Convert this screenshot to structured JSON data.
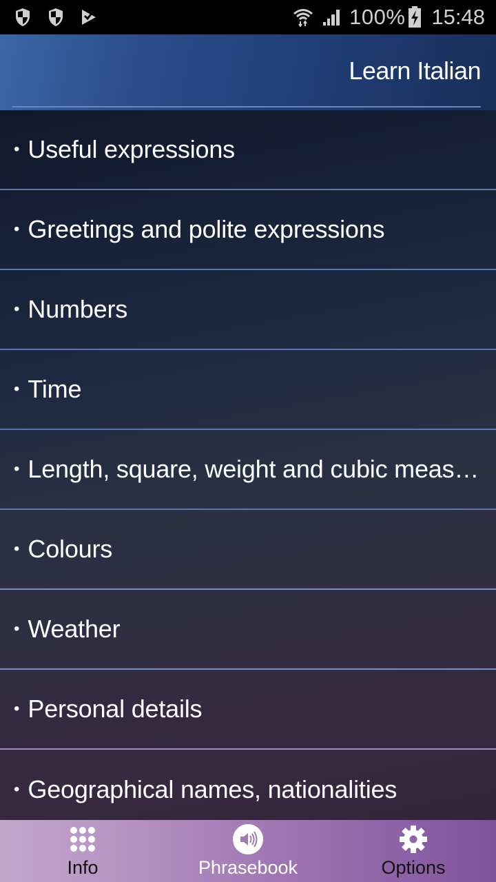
{
  "status_bar": {
    "left_icons": [
      "shield-icon",
      "shield-icon",
      "play-store-check-icon"
    ],
    "wifi_icon": "wifi-icon",
    "signal_icon": "signal-icon",
    "battery_percent": "100%",
    "battery_icon": "battery-charging-icon",
    "time": "15:48"
  },
  "header": {
    "title": "Learn Italian"
  },
  "topics": [
    {
      "label": "Useful expressions"
    },
    {
      "label": "Greetings and polite expressions"
    },
    {
      "label": "Numbers"
    },
    {
      "label": "Time"
    },
    {
      "label": "Length, square, weight and cubic measures"
    },
    {
      "label": "Colours"
    },
    {
      "label": "Weather"
    },
    {
      "label": "Personal details"
    },
    {
      "label": "Geographical names, nationalities"
    }
  ],
  "bullet": "•",
  "bottom_nav": {
    "items": [
      {
        "label": "Info",
        "icon": "grid-dots-icon",
        "active": false
      },
      {
        "label": "Phrasebook",
        "icon": "speaker-icon",
        "active": true
      },
      {
        "label": "Options",
        "icon": "gear-icon",
        "active": false
      }
    ]
  },
  "colors": {
    "header_blue": "#2a4c88",
    "separator": "#5a78b0",
    "nav_purple": "#9c72b0",
    "text": "#ffffff"
  }
}
